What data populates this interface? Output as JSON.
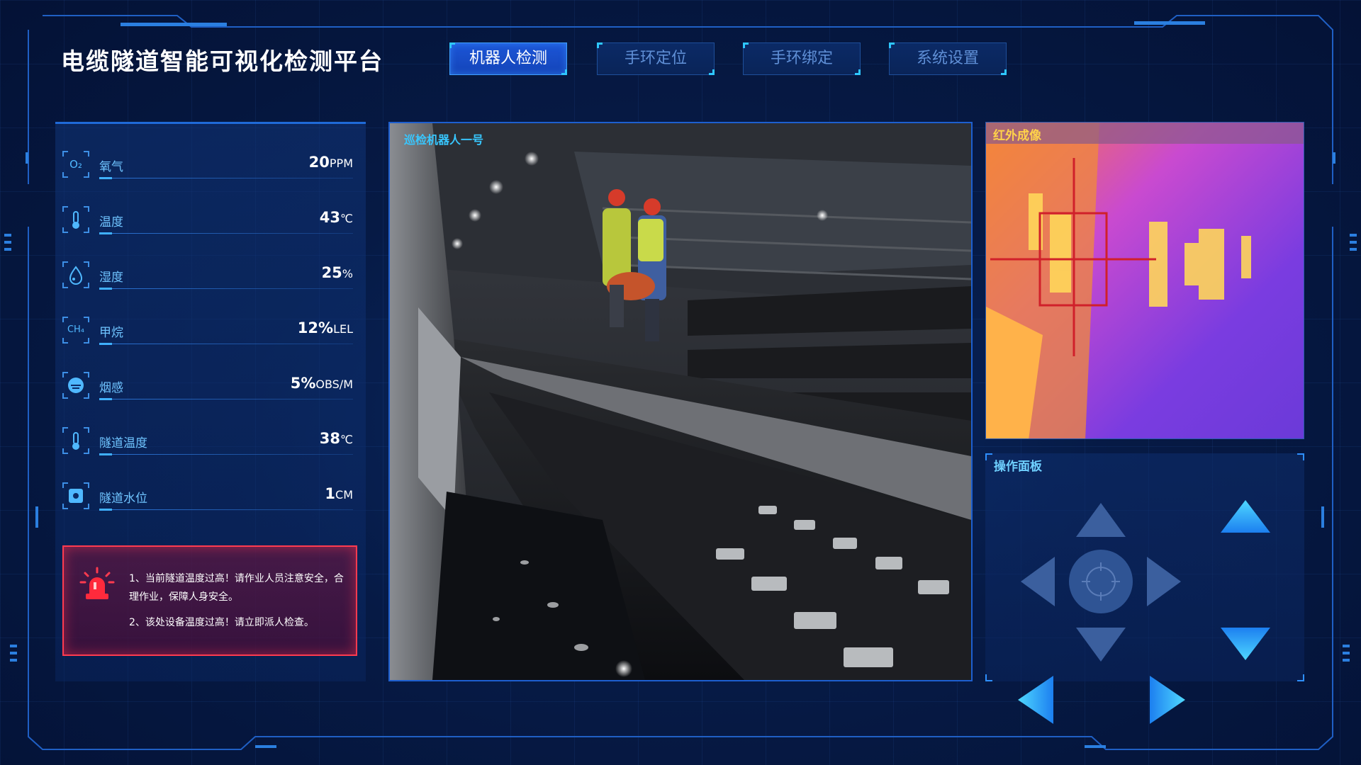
{
  "app": {
    "title": "电缆隧道智能可视化检测平台"
  },
  "nav": {
    "tabs": [
      {
        "label": "机器人检测",
        "active": true
      },
      {
        "label": "手环定位",
        "active": false
      },
      {
        "label": "手环绑定",
        "active": false
      },
      {
        "label": "系统设置",
        "active": false
      }
    ]
  },
  "sensors": [
    {
      "icon": "O₂",
      "icon_name": "oxygen-icon",
      "label": "氧气",
      "value": "20",
      "unit": "PPM"
    },
    {
      "icon": "thermometer",
      "icon_name": "thermometer-icon",
      "label": "温度",
      "value": "43",
      "unit": "℃"
    },
    {
      "icon": "droplet",
      "icon_name": "humidity-icon",
      "label": "湿度",
      "value": "25",
      "unit": "%"
    },
    {
      "icon": "CH₄",
      "icon_name": "methane-icon",
      "label": "甲烷",
      "value": "12%",
      "unit": "LEL"
    },
    {
      "icon": "smoke",
      "icon_name": "smoke-icon",
      "label": "烟感",
      "value": "5%",
      "unit": "OBS/M"
    },
    {
      "icon": "thermometer",
      "icon_name": "tunnel-thermometer-icon",
      "label": "隧道温度",
      "value": "38",
      "unit": "℃"
    },
    {
      "icon": "water",
      "icon_name": "water-level-icon",
      "label": "隧道水位",
      "value": "1",
      "unit": "CM"
    }
  ],
  "alert": {
    "lines": [
      "1、当前隧道温度过高！请作业人员注意安全，合理作业，保障人身安全。",
      "2、该处设备温度过高！请立即派人检查。"
    ]
  },
  "video": {
    "title": "巡检机器人一号"
  },
  "infrared": {
    "title": "红外成像"
  },
  "operation": {
    "title": "操作面板"
  },
  "colors": {
    "accent": "#1c56d8",
    "frame": "#1f6ad8",
    "alert": "#ff3b4f",
    "highlight": "#38c7ff"
  }
}
